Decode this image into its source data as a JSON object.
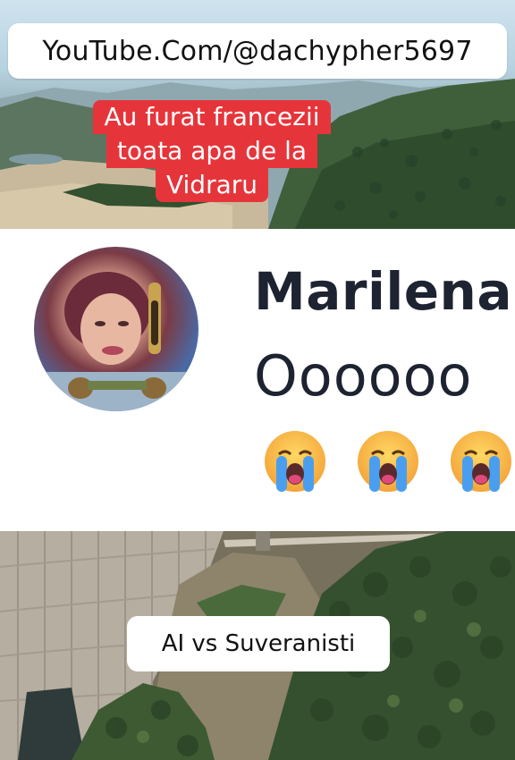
{
  "top_overlay": {
    "url_banner_text": "YouTube.Com/@dachypher5697",
    "caption_lines": [
      "Au furat francezii",
      "toata apa de la",
      "Vidraru"
    ]
  },
  "comment": {
    "name": "Marilena",
    "text": "Oooooo",
    "emoji_icons": [
      "loudly-crying-face-icon",
      "loudly-crying-face-icon",
      "loudly-crying-face-icon"
    ]
  },
  "bottom_overlay": {
    "caption_text": "AI vs Suveranisti"
  },
  "colors": {
    "caption_red": "#e5353b",
    "banner_white": "#ffffff",
    "comment_text": "#1d2330"
  }
}
